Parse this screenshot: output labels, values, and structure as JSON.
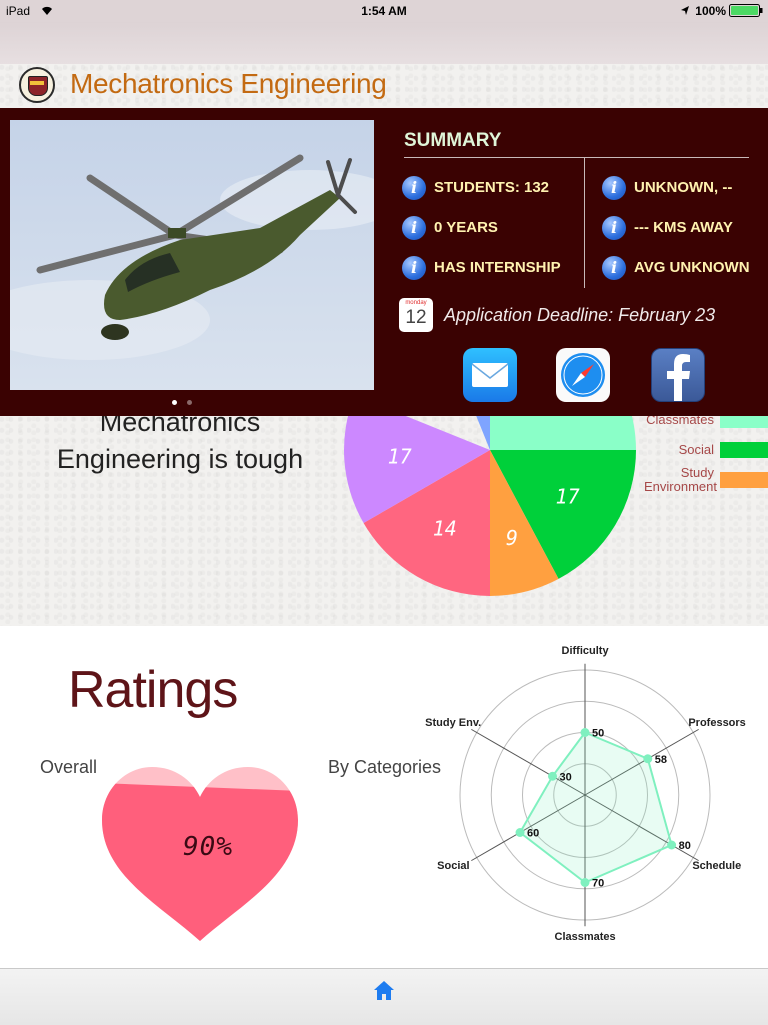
{
  "status_bar": {
    "device": "iPad",
    "time": "1:54 AM",
    "battery": "100%"
  },
  "header": {
    "title": "Mechatronics Engineering"
  },
  "summary": {
    "title": "SUMMARY",
    "items": [
      {
        "label": "STUDENTS: 132"
      },
      {
        "label": "UNKNOWN, --"
      },
      {
        "label": "0 YEARS"
      },
      {
        "label": "--- KMS AWAY"
      },
      {
        "label": "HAS INTERNSHIP"
      },
      {
        "label": "AVG UNKNOWN"
      }
    ],
    "calendar": {
      "month": "monday",
      "day": "12"
    },
    "deadline": "Application Deadline: February 23"
  },
  "carousel": {
    "page_count": 2,
    "current_page": 1
  },
  "share_icons": [
    "mail-icon",
    "safari-icon",
    "facebook-icon"
  ],
  "tough_text_line1": "Mechatronics",
  "tough_text_line2": "Engineering is tough",
  "chart_data": [
    {
      "type": "pie",
      "slice_labels": [
        "17",
        "9",
        "14",
        "17"
      ],
      "slice_values": [
        17,
        9,
        14,
        17
      ],
      "legend": [
        {
          "name": "Classmates",
          "color": "#8affc8"
        },
        {
          "name": "Social",
          "color": "#00d03a"
        },
        {
          "name": "Study Environment",
          "color": "#ffa040"
        }
      ],
      "slice_colors": [
        "#00d03a",
        "#ffa040",
        "#ff6680",
        "#cc88ff"
      ]
    },
    {
      "type": "radar",
      "axes": [
        "Difficulty",
        "Professors",
        "Schedule",
        "Classmates",
        "Social",
        "Study Env."
      ],
      "values": [
        50,
        58,
        80,
        70,
        60,
        30
      ],
      "max": 100,
      "color": "#7ff0bf"
    }
  ],
  "ratings": {
    "title": "Ratings",
    "overall_label": "Overall",
    "by_categories_label": "By Categories",
    "overall_value": "90%",
    "overall_fraction": 0.9
  },
  "tabbar": {
    "icons": [
      "home-icon"
    ]
  }
}
